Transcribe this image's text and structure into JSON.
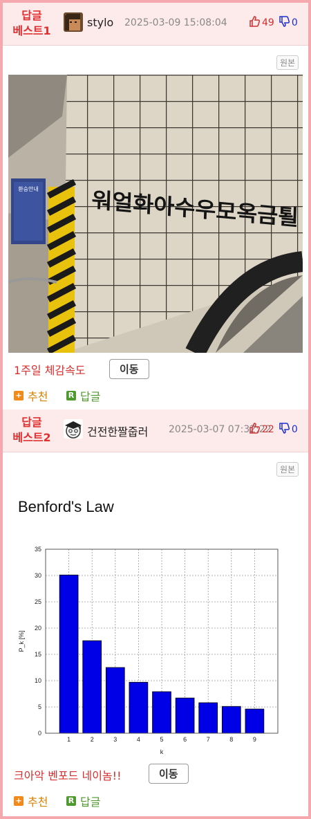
{
  "posts": [
    {
      "best_line1": "답글",
      "best_line2": "베스트1",
      "author": "stylo",
      "datetime": "2025-03-09 15:08:04",
      "upvotes": "49",
      "downvotes": "0",
      "original_label": "원본",
      "photo_sign_text": "워얼화아수우모옥금퇼",
      "photo_station_sign": "환승안내",
      "caption": "1주일 체감속도",
      "move_label": "이동",
      "recommend_label": "추천",
      "reply_label": "답글",
      "recommend_icon": "+",
      "reply_icon": "R"
    },
    {
      "best_line1": "답글",
      "best_line2": "베스트2",
      "author": "건전한짤줍러",
      "datetime": "2025-03-07 07:32:22",
      "upvotes": "22",
      "downvotes": "0",
      "original_label": "원본",
      "caption": "크아악 벤포드 네이놈!!",
      "move_label": "이동",
      "recommend_label": "추천",
      "reply_label": "답글",
      "recommend_icon": "+",
      "reply_icon": "R"
    }
  ],
  "colors": {
    "border": "#f5a9ae",
    "header_bg": "#fdeaea",
    "best_red": "#e03030",
    "bar_blue": "#0000e6"
  },
  "chart_data": {
    "type": "bar",
    "title": "Benford's Law",
    "xlabel": "k",
    "ylabel": "P_k [%]",
    "categories": [
      "1",
      "2",
      "3",
      "4",
      "5",
      "6",
      "7",
      "8",
      "9"
    ],
    "values": [
      30.1,
      17.6,
      12.5,
      9.7,
      7.9,
      6.7,
      5.8,
      5.1,
      4.6
    ],
    "ylim": [
      0,
      35
    ],
    "yticks": [
      "0",
      "5",
      "10",
      "15",
      "20",
      "25",
      "30",
      "35"
    ],
    "grid": true
  }
}
